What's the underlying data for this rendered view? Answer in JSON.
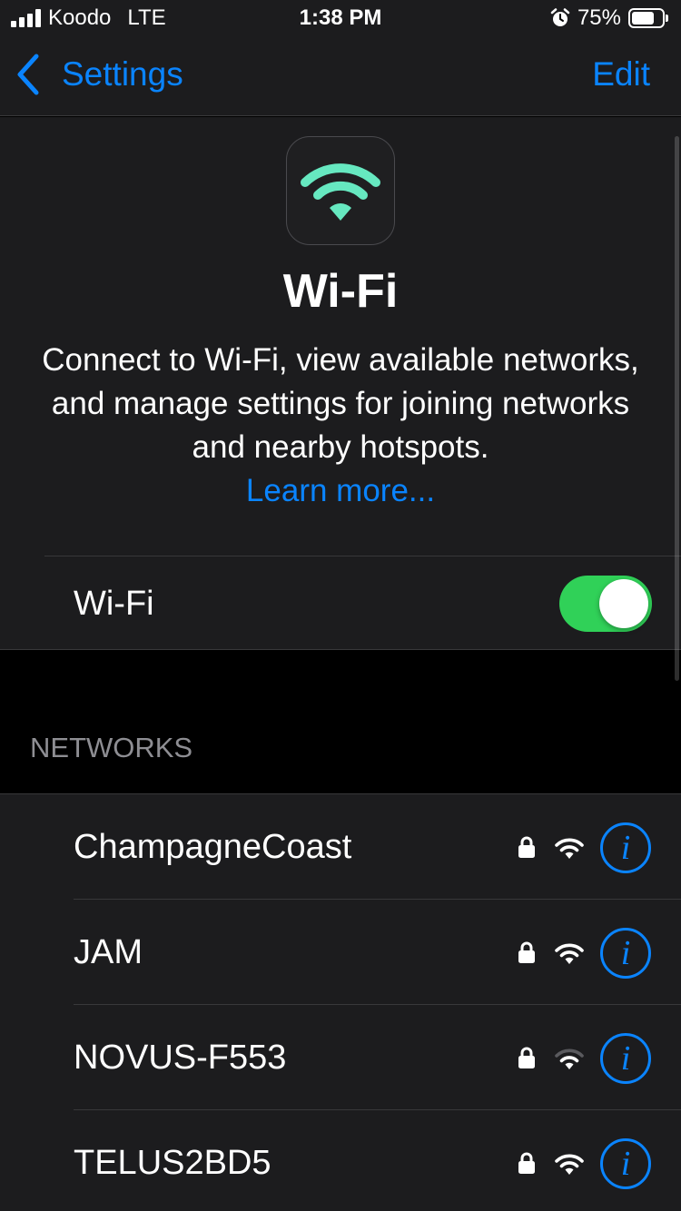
{
  "status_bar": {
    "carrier": "Koodo",
    "network_type": "LTE",
    "time": "1:38 PM",
    "battery_percent": "75%",
    "battery_level": 0.75,
    "signal_strength": 4,
    "icons": [
      "signal-icon",
      "alarm-icon",
      "battery-icon"
    ]
  },
  "nav": {
    "back_label": "Settings",
    "edit_label": "Edit",
    "back_icon": "chevron-left-icon"
  },
  "header": {
    "icon": "wifi-icon",
    "title": "Wi-Fi",
    "description": "Connect to Wi-Fi, view available networks, and manage settings for joining networks and nearby hotspots.",
    "learn_more": "Learn more..."
  },
  "wifi_toggle": {
    "label": "Wi-Fi",
    "on": true
  },
  "networks": {
    "section_title": "NETWORKS",
    "items": [
      {
        "name": "ChampagneCoast",
        "locked": true,
        "signal": 3,
        "info_icon": "info-icon"
      },
      {
        "name": "JAM",
        "locked": true,
        "signal": 3,
        "info_icon": "info-icon"
      },
      {
        "name": "NOVUS-F553",
        "locked": true,
        "signal": 2,
        "info_icon": "info-icon"
      },
      {
        "name": "TELUS2BD5",
        "locked": true,
        "signal": 3,
        "info_icon": "info-icon"
      }
    ]
  },
  "colors": {
    "accent": "#0a84ff",
    "toggle_on": "#30d158",
    "wifi_glyph": "#66e8c0",
    "background": "#000000",
    "cell_background": "#1c1c1e",
    "secondary_text": "#8e8e93"
  }
}
